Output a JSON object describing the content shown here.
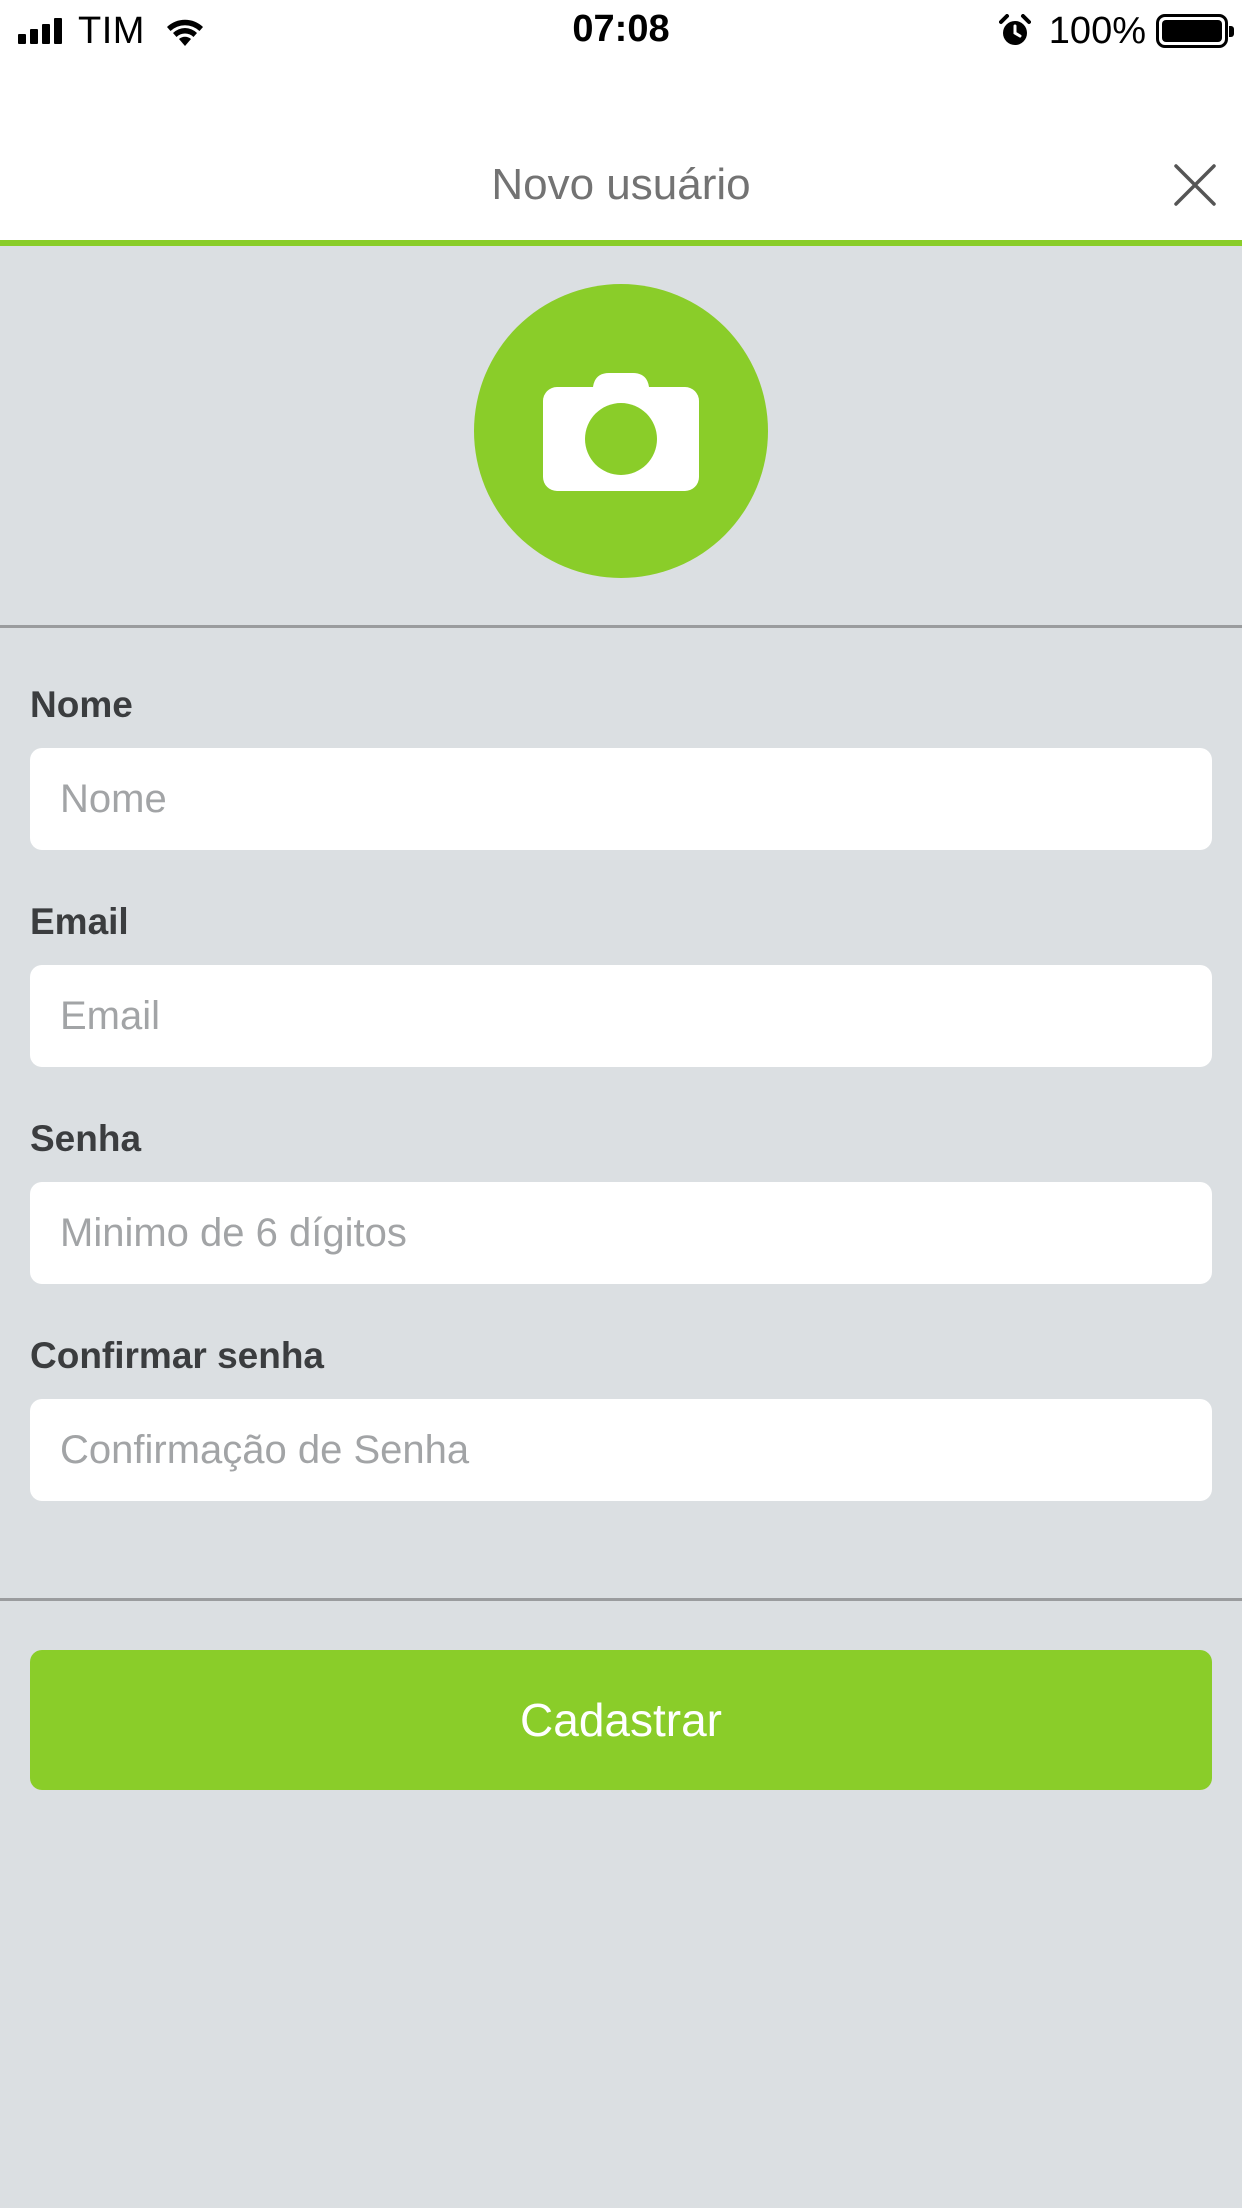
{
  "status_bar": {
    "carrier": "TIM",
    "time": "07:08",
    "battery_percent": "100%",
    "icons": [
      "signal-bars-icon",
      "wifi-icon",
      "alarm-icon",
      "battery-icon"
    ]
  },
  "header": {
    "title": "Novo usuário",
    "close_icon": "close-icon"
  },
  "avatar": {
    "icon": "camera-icon"
  },
  "form": {
    "nome": {
      "label": "Nome",
      "placeholder": "Nome",
      "value": ""
    },
    "email": {
      "label": "Email",
      "placeholder": "Email",
      "value": ""
    },
    "senha": {
      "label": "Senha",
      "placeholder": "Minimo de 6 dígitos",
      "value": ""
    },
    "confirmar": {
      "label": "Confirmar senha",
      "placeholder": "Confirmação de Senha",
      "value": ""
    }
  },
  "submit": {
    "label": "Cadastrar"
  },
  "colors": {
    "accent": "#8acd29",
    "background": "#dbdfe2",
    "label": "#3b3d3f",
    "title": "#737373"
  }
}
